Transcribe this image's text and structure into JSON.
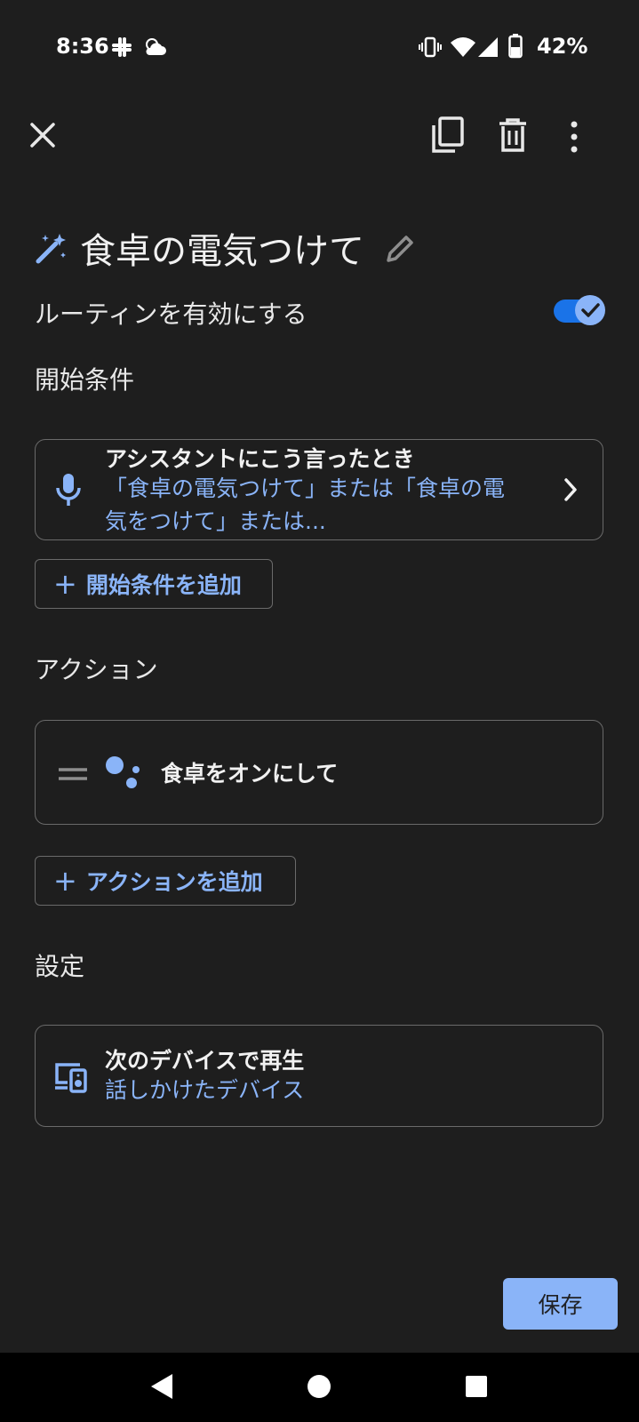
{
  "status_bar": {
    "time": "8:36",
    "battery": "42%"
  },
  "routine": {
    "title": "食卓の電気つけて",
    "enable_label": "ルーティンを有効にする",
    "enabled": true
  },
  "starters": {
    "heading": "開始条件",
    "card_title": "アシスタントにこう言ったとき",
    "card_line1": "「食卓の電気つけて」または「食卓の電",
    "card_line2": "気をつけて」または...",
    "add_label": "開始条件を追加"
  },
  "actions": {
    "heading": "アクション",
    "item_label": "食卓をオンにして",
    "add_label": "アクションを追加"
  },
  "settings": {
    "heading": "設定",
    "card_title": "次のデバイスで再生",
    "card_value": "話しかけたデバイス"
  },
  "save_label": "保存",
  "accent_color": "#8ab4f8",
  "icons": [
    "close-icon",
    "copy-icon",
    "delete-icon",
    "more-vert-icon",
    "magic-wand-icon",
    "edit-icon",
    "mic-icon",
    "chevron-right-icon",
    "drag-handle-icon",
    "assistant-icon",
    "speaker-device-icon",
    "back-icon",
    "home-icon",
    "recents-icon"
  ]
}
